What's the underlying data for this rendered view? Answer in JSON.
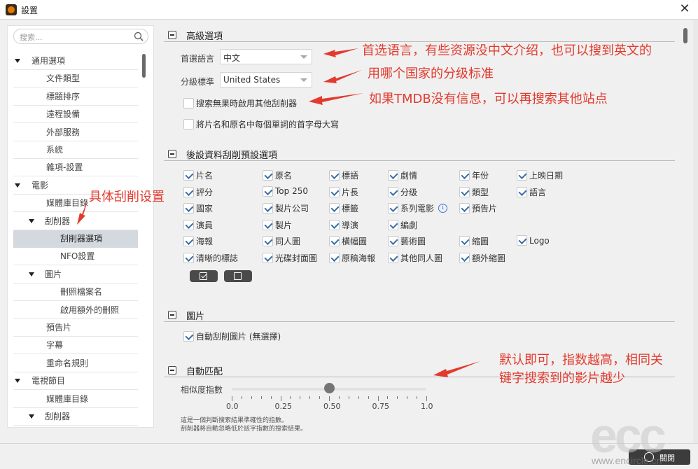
{
  "window": {
    "title": "設置",
    "close_glyph": "✕"
  },
  "sidebar": {
    "search_placeholder": "搜索...",
    "items": [
      {
        "label": "通用選項",
        "level": 0,
        "expanded": true
      },
      {
        "label": "文件類型",
        "level": 2
      },
      {
        "label": "標題排序",
        "level": 2
      },
      {
        "label": "遠程設備",
        "level": 2
      },
      {
        "label": "外部服務",
        "level": 2
      },
      {
        "label": "系統",
        "level": 2
      },
      {
        "label": "雜項-設置",
        "level": 2
      },
      {
        "label": "電影",
        "level": 0,
        "expanded": true
      },
      {
        "label": "媒體庫目錄",
        "level": 2
      },
      {
        "label": "刮削器",
        "level": 1,
        "expanded": true
      },
      {
        "label": "刮削器選項",
        "level": 3,
        "selected": true
      },
      {
        "label": "NFO設置",
        "level": 3
      },
      {
        "label": "圖片",
        "level": 1,
        "expanded": true
      },
      {
        "label": "刪照檔案名",
        "level": 3
      },
      {
        "label": "啟用額外的刪照",
        "level": 3
      },
      {
        "label": "預告片",
        "level": 2
      },
      {
        "label": "字幕",
        "level": 2
      },
      {
        "label": "重命名規則",
        "level": 2
      },
      {
        "label": "電視節目",
        "level": 0,
        "expanded": true
      },
      {
        "label": "媒體庫目錄",
        "level": 2
      },
      {
        "label": "刮削器",
        "level": 1,
        "expanded": true
      }
    ]
  },
  "advanced": {
    "title": "高級選項",
    "language_label": "首選語言",
    "language_value": "中文",
    "cert_label": "分級標準",
    "cert_value": "United States",
    "fallback_label": "搜索無果時啟用其他刮削器",
    "fallback_checked": false,
    "capitalize_label": "將片名和原名中每個單詞的首字母大寫",
    "capitalize_checked": false
  },
  "post": {
    "title": "後設資料刮削預設選項",
    "fields": [
      [
        "片名",
        "原名",
        "標語",
        "劇情",
        "年份",
        "上映日期"
      ],
      [
        "評分",
        "Top 250",
        "片長",
        "分级",
        "類型",
        "語言"
      ],
      [
        "國家",
        "製片公司",
        "標籤",
        "系列電影",
        "預告片"
      ],
      [
        "演員",
        "製片",
        "導演",
        "編劇"
      ],
      [
        "海報",
        "同人圖",
        "橫幅圖",
        "藝術圖",
        "縮圖",
        "Logo"
      ],
      [
        "清晰的標誌",
        "光碟封面圖",
        "原稿海報",
        "其他同人圖",
        "額外縮圖"
      ]
    ]
  },
  "images": {
    "title": "圖片",
    "auto_label": "自動刮削圖片 (無選擇)",
    "auto_checked": true
  },
  "automatch": {
    "title": "自動匹配",
    "label": "相似度指數",
    "value": 0.5,
    "ticks": [
      "0.0",
      "0.25",
      "0.50",
      "0.75",
      "1.0"
    ],
    "note1": "這是一個判斷搜索結果準確性的指數。",
    "note2": "刮削器將自動忽略低於該字指數的搜索結果。"
  },
  "footer": {
    "ok_label": "關閉"
  },
  "annotations": {
    "a1": "首选语言，有些资源没中文介绍，也可以搜到英文的",
    "a2": "用哪个国家的分级标准",
    "a3": "如果TMDB没有信息，可以再搜索其他站点",
    "a4": "具体刮削设置",
    "a5": "默认即可，指数越高，相同关",
    "a6": "键字搜索到的影片越少",
    "color": "#e23b2e"
  },
  "watermark": {
    "text": "ecc",
    "url": "www.encircle.cn"
  }
}
